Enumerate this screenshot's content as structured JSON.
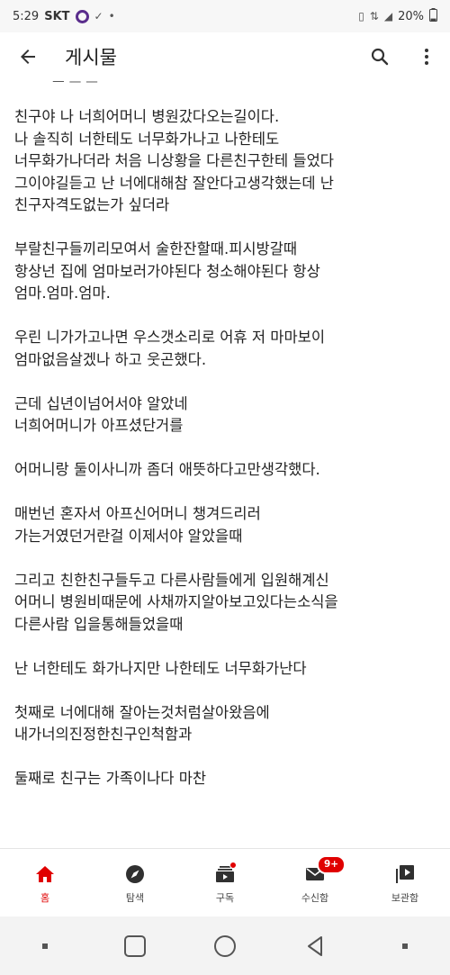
{
  "status_bar": {
    "time": "5:29",
    "carrier": "SKT",
    "battery": "20%",
    "battery_level_percent": 20
  },
  "app_bar": {
    "title": "게시물",
    "back_icon": "arrow-left-icon",
    "search_icon": "search-icon",
    "more_icon": "more-vert-icon"
  },
  "post": {
    "clipped_top": "ㅡ ᅳ ᅳ",
    "paragraphs": [
      [
        "친구야 나 너희어머니 병원갔다오는길이다.",
        "나 솔직히 너한테도 너무화가나고 나한테도",
        "너무화가나더라 처음 니상황을 다른친구한테 들었다",
        "그이야길듣고 난 너에대해참 잘안다고생각했는데 난",
        "친구자격도없는가 싶더라"
      ],
      [
        "부랄친구들끼리모여서 술한잔할때.피시방갈때",
        "항상넌 집에 엄마보러가야된다 청소해야된다 항상",
        "엄마.엄마.엄마."
      ],
      [
        "우린 니가가고나면 우스갯소리로 어휴 저 마마보이",
        "엄마없음살겠나 하고 웃곤했다."
      ],
      [
        "근데 십년이넘어서야 알았네",
        "너희어머니가 아프셨단거를"
      ],
      [
        "어머니랑 둘이사니까 좀더 애뜻하다고만생각했다."
      ],
      [
        "매번넌 혼자서 아프신어머니 챙겨드리러",
        "가는거였던거란걸 이제서야 알았을때"
      ],
      [
        "그리고 친한친구들두고 다른사람들에게 입원해계신",
        "어머니 병원비때문에 사채까지알아보고있다는소식을",
        "다른사람 입을통해들었을때"
      ],
      [
        "난 너한테도 화가나지만 나한테도 너무화가난다"
      ],
      [
        "첫째로 너에대해 잘아는것처럼살아왔음에",
        "내가너의진정한친구인척함과"
      ],
      [
        "둘째로 친구는 가족이나다 마찬"
      ]
    ]
  },
  "bottom_nav": {
    "items": [
      {
        "label": "홈",
        "icon": "home-icon",
        "active": true
      },
      {
        "label": "탐색",
        "icon": "explore-icon",
        "active": false
      },
      {
        "label": "구독",
        "icon": "subscriptions-icon",
        "active": false
      },
      {
        "label": "수신함",
        "icon": "inbox-icon",
        "active": false,
        "badge": "9+"
      },
      {
        "label": "보관함",
        "icon": "library-icon",
        "active": false
      }
    ]
  },
  "colors": {
    "accent": "#e00000",
    "text": "#222222",
    "nav_bg": "#f3f3f3"
  }
}
